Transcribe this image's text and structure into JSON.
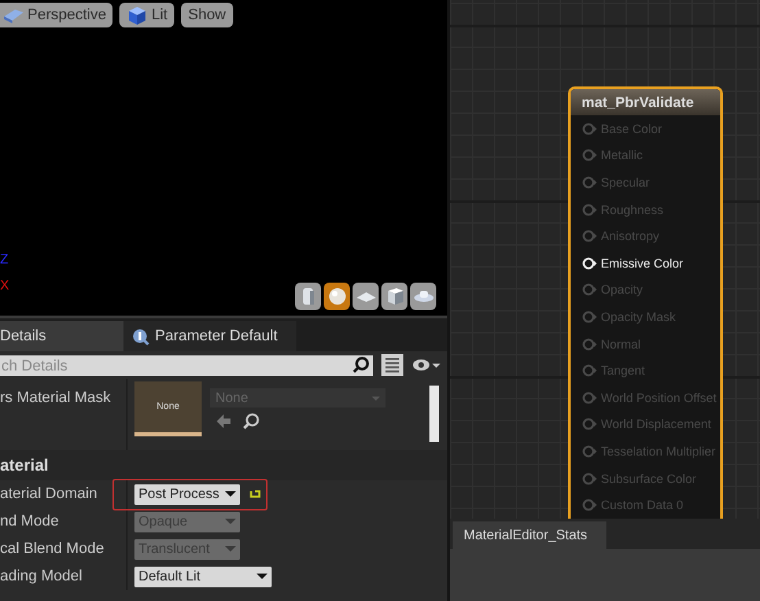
{
  "viewport": {
    "buttons": [
      {
        "label": "Perspective"
      },
      {
        "label": "Lit"
      },
      {
        "label": "Show"
      }
    ],
    "axes": [
      {
        "label": "Z",
        "color": "#2a2aff"
      },
      {
        "label": "X",
        "color": "#e01010"
      }
    ],
    "preview_shapes": [
      {
        "selected": false
      },
      {
        "selected": true
      },
      {
        "selected": false
      },
      {
        "selected": false
      },
      {
        "selected": false
      }
    ]
  },
  "details": {
    "tabs": [
      {
        "label": "Details",
        "selected": true
      },
      {
        "label": "Parameter Default",
        "selected": false
      }
    ],
    "search": {
      "placeholder": "ch Details"
    },
    "rows": [
      {
        "kind": "asset",
        "label": "rs Material Mask",
        "thumbnail": "None",
        "value": "None"
      },
      {
        "kind": "section",
        "label": "aterial"
      },
      {
        "kind": "dropdown",
        "label": "aterial Domain",
        "value": "Post Process",
        "disabled": false,
        "highlighted": true,
        "reset": true
      },
      {
        "kind": "dropdown",
        "label": "nd Mode",
        "value": "Opaque",
        "disabled": true,
        "highlighted": false,
        "reset": false
      },
      {
        "kind": "dropdown",
        "label": "cal Blend Mode",
        "value": "Translucent",
        "disabled": true,
        "highlighted": false,
        "reset": false
      },
      {
        "kind": "dropdown",
        "label": "ading Model",
        "value": "Default Lit",
        "disabled": false,
        "highlighted": false,
        "reset": false
      }
    ]
  },
  "graph": {
    "node": {
      "title": "mat_PbrValidate",
      "pins": [
        {
          "label": "Base Color",
          "enabled": false
        },
        {
          "label": "Metallic",
          "enabled": false
        },
        {
          "label": "Specular",
          "enabled": false
        },
        {
          "label": "Roughness",
          "enabled": false
        },
        {
          "label": "Anisotropy",
          "enabled": false
        },
        {
          "label": "Emissive Color",
          "enabled": true
        },
        {
          "label": "Opacity",
          "enabled": false
        },
        {
          "label": "Opacity Mask",
          "enabled": false
        },
        {
          "label": "Normal",
          "enabled": false
        },
        {
          "label": "Tangent",
          "enabled": false
        },
        {
          "label": "World Position Offset",
          "enabled": false
        },
        {
          "label": "World Displacement",
          "enabled": false
        },
        {
          "label": "Tesselation Multiplier",
          "enabled": false
        },
        {
          "label": "Subsurface Color",
          "enabled": false
        },
        {
          "label": "Custom Data 0",
          "enabled": false
        }
      ]
    },
    "stats_tab": {
      "label": "MaterialEditor_Stats"
    }
  }
}
